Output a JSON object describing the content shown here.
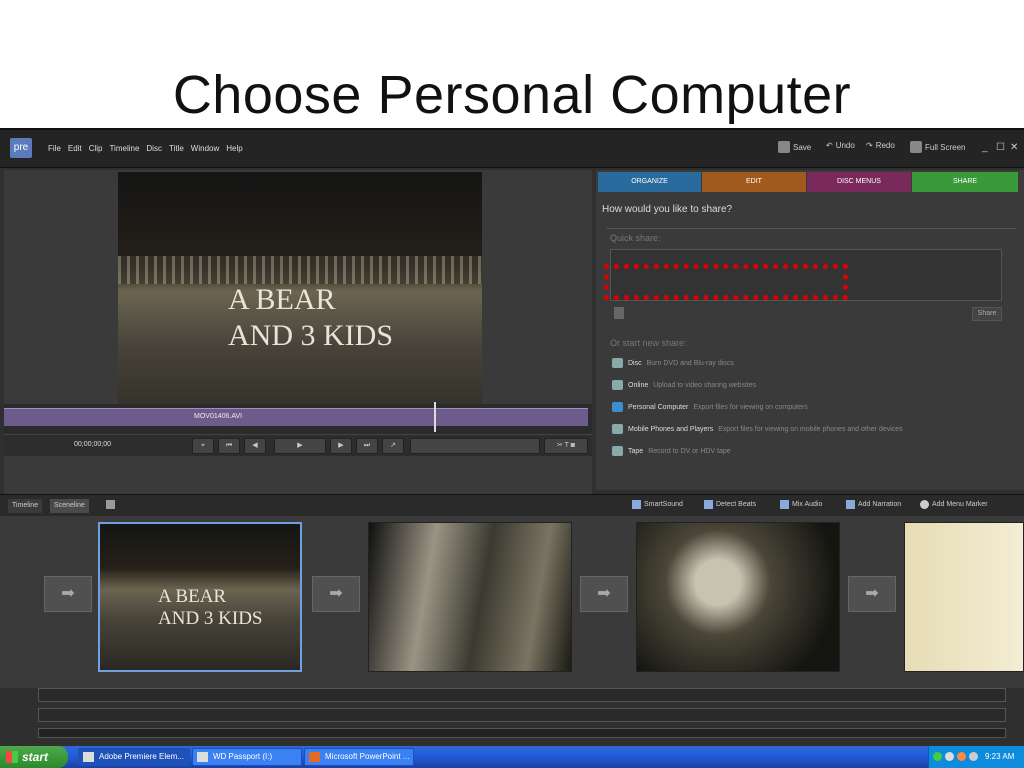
{
  "slide": {
    "title": "Choose Personal Computer"
  },
  "app": {
    "logo": "pre",
    "menus": [
      "File",
      "Edit",
      "Clip",
      "Timeline",
      "Disc",
      "Title",
      "Window",
      "Help"
    ],
    "toolbar": {
      "save": "Save",
      "undo": "Undo",
      "redo": "Redo",
      "fullscreen": "Full Screen"
    },
    "window_controls": [
      "_",
      "☐",
      "✕"
    ]
  },
  "monitor": {
    "video_overlay_line1": "A BEAR",
    "video_overlay_line2": "AND 3 KIDS",
    "clip_name": "MOV01406.AVI",
    "timecode": "00;00;00;00"
  },
  "tabs": [
    {
      "label": "ORGANIZE",
      "color": "#2a6b9e"
    },
    {
      "label": "EDIT",
      "color": "#a05a1e"
    },
    {
      "label": "DISC MENUS",
      "color": "#7a2a5a"
    },
    {
      "label": "SHARE",
      "color": "#3a9a3a"
    }
  ],
  "share": {
    "question": "How would you like to share?",
    "quick_share_label": "Quick share:",
    "share_button": "Share",
    "new_share_label": "Or start new share:",
    "options": [
      {
        "name": "Disc",
        "desc": "Burn DVD and Blu-ray discs",
        "icon": "disc-icon"
      },
      {
        "name": "Online",
        "desc": "Upload to video sharing websites",
        "icon": "globe-icon"
      },
      {
        "name": "Personal Computer",
        "desc": "Export files for viewing on computers",
        "icon": "computer-icon"
      },
      {
        "name": "Mobile Phones and Players",
        "desc": "Export files for viewing on mobile phones and other devices",
        "icon": "phone-icon"
      },
      {
        "name": "Tape",
        "desc": "Record to DV or HDV tape",
        "icon": "tape-icon"
      }
    ],
    "highlight_color": "#e00000"
  },
  "lower_toolbar": {
    "timeline_tab": "Timeline",
    "sceneline_tab": "Sceneline",
    "smartsound": "SmartSound",
    "detect_beats": "Detect Beats",
    "mix_audio": "Mix Audio",
    "add_narration": "Add Narration",
    "add_menu_marker": "Add Menu Marker"
  },
  "sceneline": {
    "clip1_line1": "A BEAR",
    "clip1_line2": "AND 3 KIDS"
  },
  "taskbar": {
    "start": "start",
    "tasks": [
      "Adobe Premiere Elem...",
      "WD Passport (I:)",
      "Microsoft PowerPoint ..."
    ],
    "clock": "9:23 AM"
  }
}
